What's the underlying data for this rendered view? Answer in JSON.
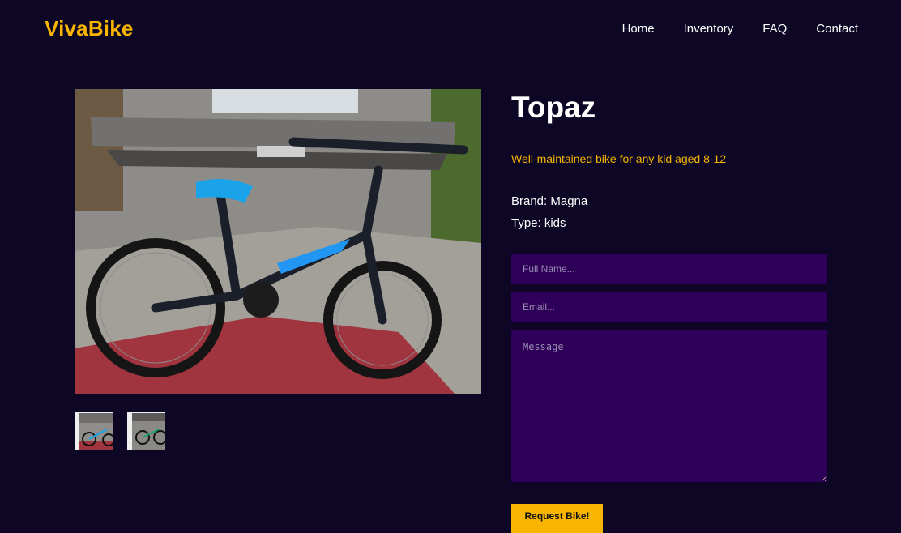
{
  "brand": {
    "logo": "VivaBike",
    "color": "#f7b500"
  },
  "nav": {
    "items": [
      {
        "label": "Home"
      },
      {
        "label": "Inventory"
      },
      {
        "label": "FAQ"
      },
      {
        "label": "Contact"
      }
    ]
  },
  "gallery": {
    "main_alt": "kids bicycle photo",
    "thumbnail_count": 2
  },
  "product": {
    "name": "Topaz",
    "tagline": "Well-maintained bike for any kid aged 8-12",
    "brand_line": "Brand: Magna",
    "type_line": "Type: kids"
  },
  "form": {
    "name_placeholder": "Full Name...",
    "email_placeholder": "Email...",
    "message_placeholder": "Message",
    "submit_label": "Request Bike!"
  },
  "colors": {
    "background": "#0d0624",
    "field": "#2e0059",
    "accent": "#f7b500"
  }
}
